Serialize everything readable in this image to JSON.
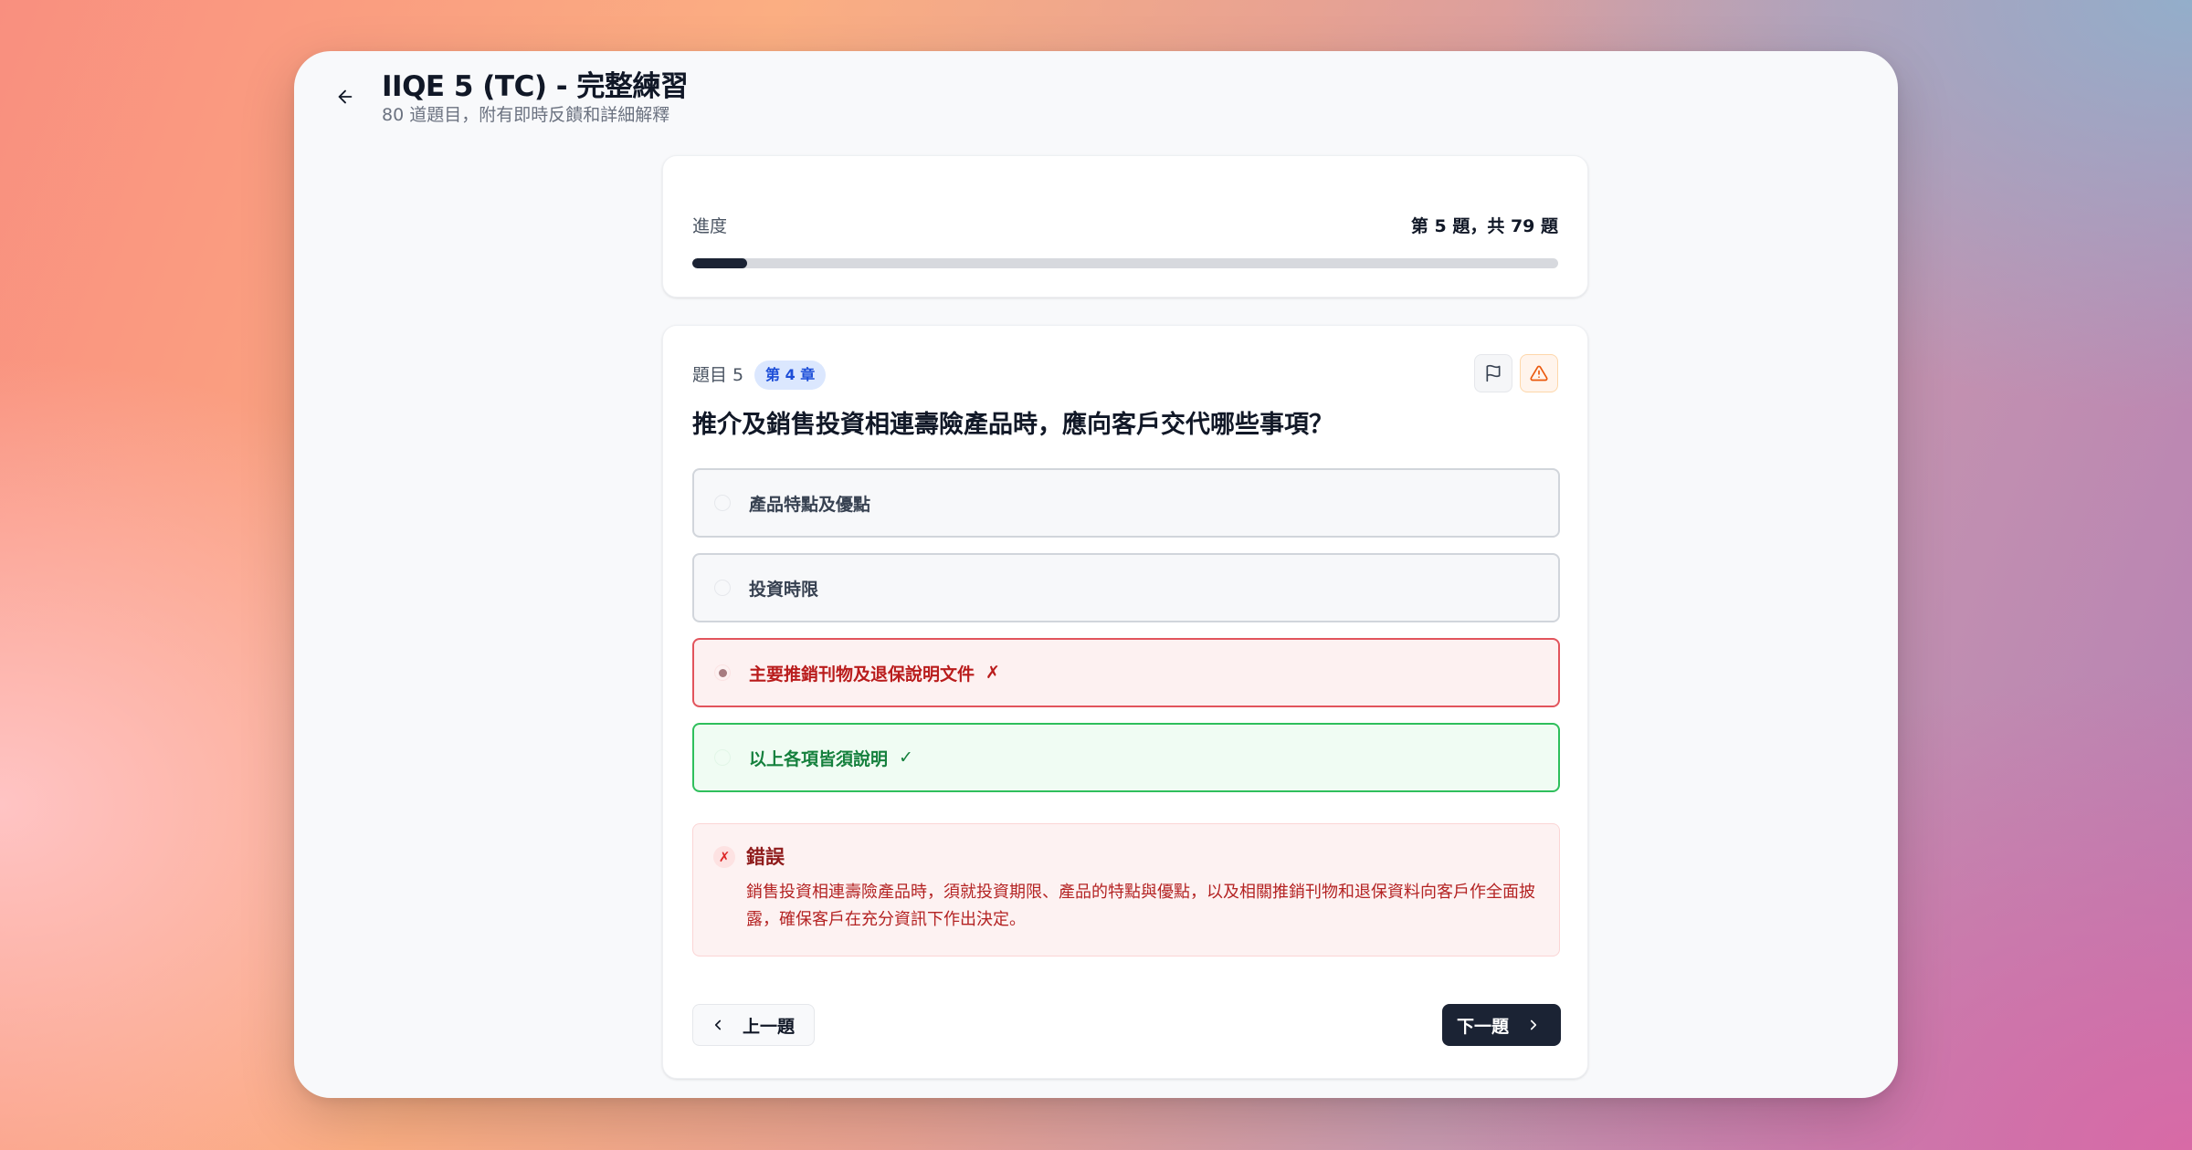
{
  "header": {
    "title": "IIQE 5 (TC) - 完整練習",
    "subtitle": "80 道題目，附有即時反饋和詳細解釋",
    "back_icon": "arrow-left-icon"
  },
  "progress": {
    "label": "進度",
    "count_text": "第 5 題，共 79 題",
    "value_percent": 6.3
  },
  "question": {
    "number_label": "題目 5",
    "chapter_badge": "第 4 章",
    "text": "推介及銷售投資相連壽險產品時，應向客戶交代哪些事項？",
    "flag_icon": "flag-icon",
    "report_icon": "warning-triangle-icon",
    "options": [
      {
        "label": "產品特點及優點",
        "state": "default",
        "mark": ""
      },
      {
        "label": "投資時限",
        "state": "default",
        "mark": ""
      },
      {
        "label": "主要推銷刊物及退保說明文件",
        "state": "selected-wrong",
        "mark": "✗"
      },
      {
        "label": "以上各項皆須說明",
        "state": "correct",
        "mark": "✓"
      }
    ]
  },
  "feedback": {
    "icon": "✗",
    "title": "錯誤",
    "text": "銷售投資相連壽險產品時，須就投資期限、產品的特點與優點，以及相關推銷刊物和退保資料向客戶作全面披露，確保客戶在充分資訊下作出決定。"
  },
  "navigation": {
    "prev_label": "上一題",
    "next_label": "下一題"
  },
  "colors": {
    "primary_dark": "#1b2334",
    "wrong": "#dc2626",
    "correct": "#16a34a",
    "chapter_badge_bg": "#dbe7fe",
    "chapter_badge_text": "#1d4ed8"
  }
}
